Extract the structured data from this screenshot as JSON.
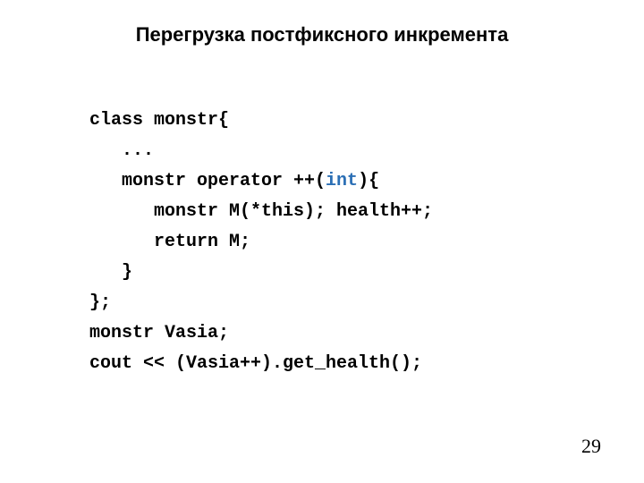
{
  "title": "Перегрузка постфиксного инкремента",
  "code": {
    "l1": "class monstr{",
    "l2": "   ...",
    "l3a": "   monstr operator ++(",
    "l3_kw": "int",
    "l3b": "){",
    "l4": "      monstr M(*this); health++;",
    "l5": "      return M;",
    "l6": "   }",
    "l7": "};",
    "l8": "monstr Vasia;",
    "l9": "cout << (Vasia++).get_health();"
  },
  "page_number": "29"
}
